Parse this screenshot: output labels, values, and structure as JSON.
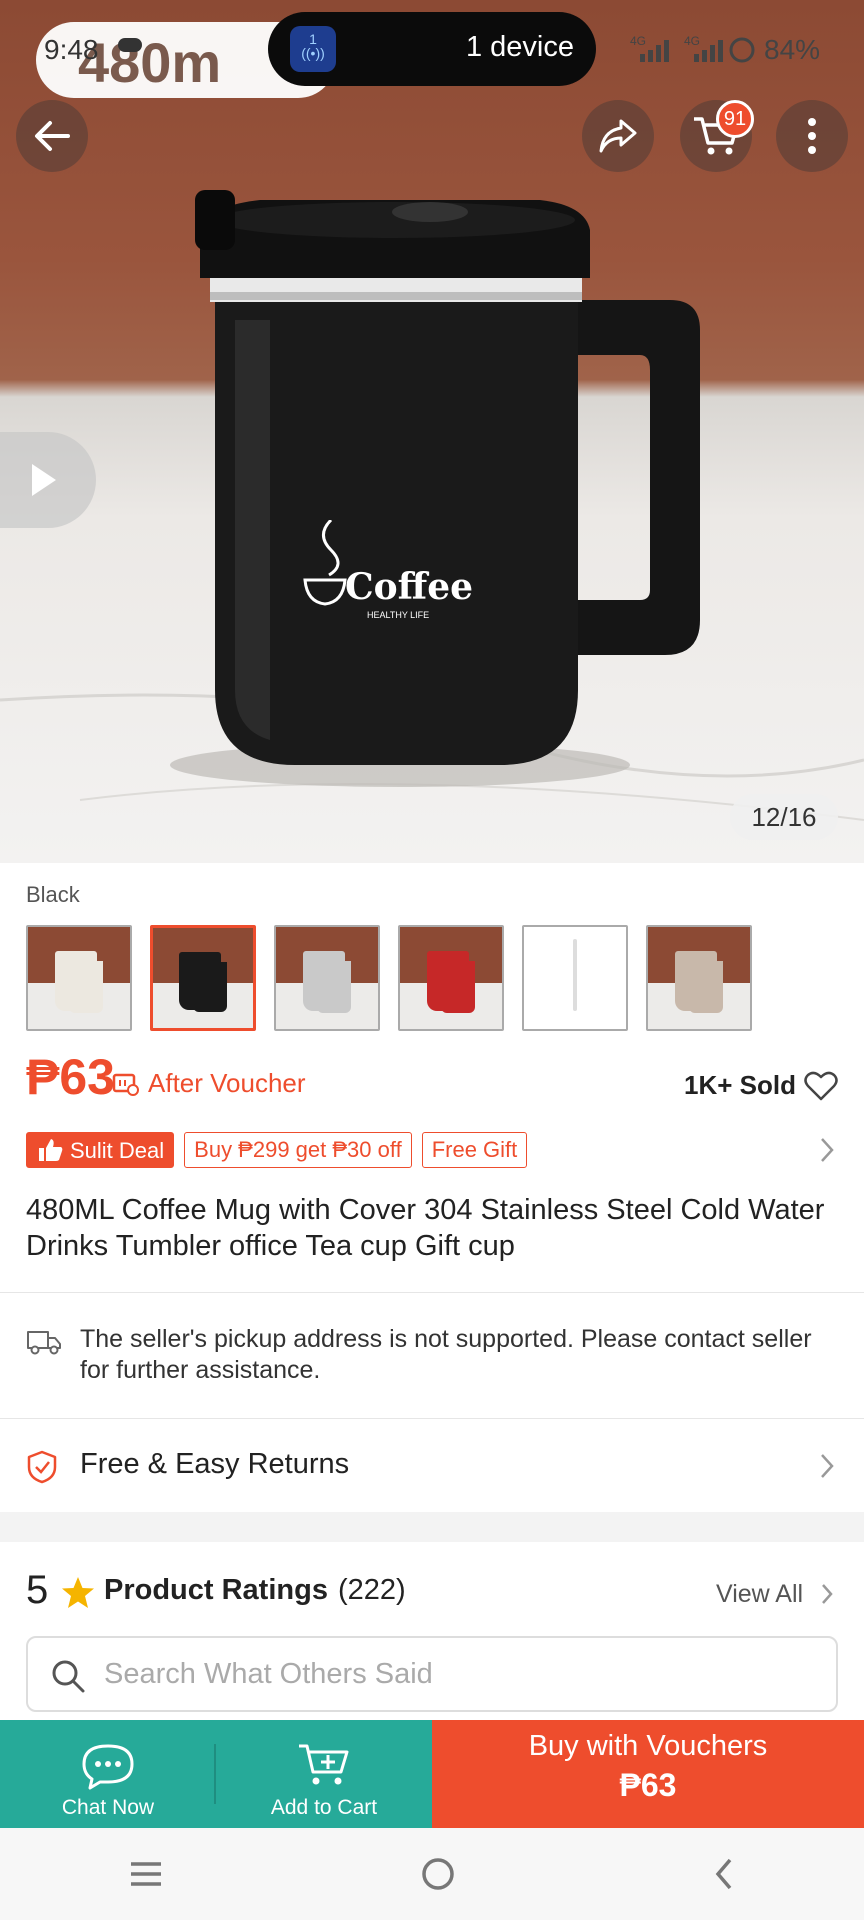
{
  "status_bar": {
    "time": "9:48",
    "overlay_text": "480m",
    "island_icon_number": "1",
    "island_text": "1 device",
    "network_1": "4G",
    "network_2": "4G",
    "battery": "84%"
  },
  "header": {
    "back_icon": "arrow-left-icon",
    "share_icon": "share-icon",
    "cart_icon": "cart-icon",
    "cart_badge": "91",
    "more_icon": "more-vertical-icon"
  },
  "gallery": {
    "mug_brand": "Coffee",
    "mug_subtext": "HEALTHY LIFE",
    "counter": "12/16"
  },
  "variant": {
    "label": "Black",
    "thumbnails": [
      {
        "color": "#ece8e0",
        "bg": "#8c4a34",
        "selected": false
      },
      {
        "color": "#1a1a1a",
        "bg": "#8c4a34",
        "selected": true
      },
      {
        "color": "#c9c9c9",
        "bg": "#8c4a34",
        "selected": false
      },
      {
        "color": "#c62828",
        "bg": "#8c4a34",
        "selected": false
      },
      {
        "color": "#ffffff",
        "bg": "#ffffff",
        "selected": false
      },
      {
        "color": "#c8b8aa",
        "bg": "#8c4a34",
        "selected": false
      }
    ]
  },
  "price": {
    "amount": "₱63",
    "after_voucher": "After Voucher",
    "sold": "1K+ Sold"
  },
  "tags": {
    "deal": "Sulit Deal",
    "promo": "Buy ₱299 get ₱30 off",
    "gift": "Free Gift"
  },
  "product": {
    "title": "480ML Coffee Mug with Cover 304 Stainless Steel Cold Water Drinks Tumbler office Tea cup Gift cup"
  },
  "shipping": {
    "notice": "The seller's pickup address is not supported. Please contact seller for further assistance."
  },
  "returns": {
    "label": "Free & Easy Returns"
  },
  "ratings": {
    "score": "5",
    "label": "Product Ratings",
    "count": "(222)",
    "view_all": "View All",
    "search_placeholder": "Search What Others Said"
  },
  "bottom_bar": {
    "chat": "Chat Now",
    "add_to_cart": "Add to Cart",
    "buy_label": "Buy with Vouchers",
    "buy_price": "₱63"
  },
  "colors": {
    "accent": "#ee4d2d",
    "teal": "#26aa99"
  }
}
